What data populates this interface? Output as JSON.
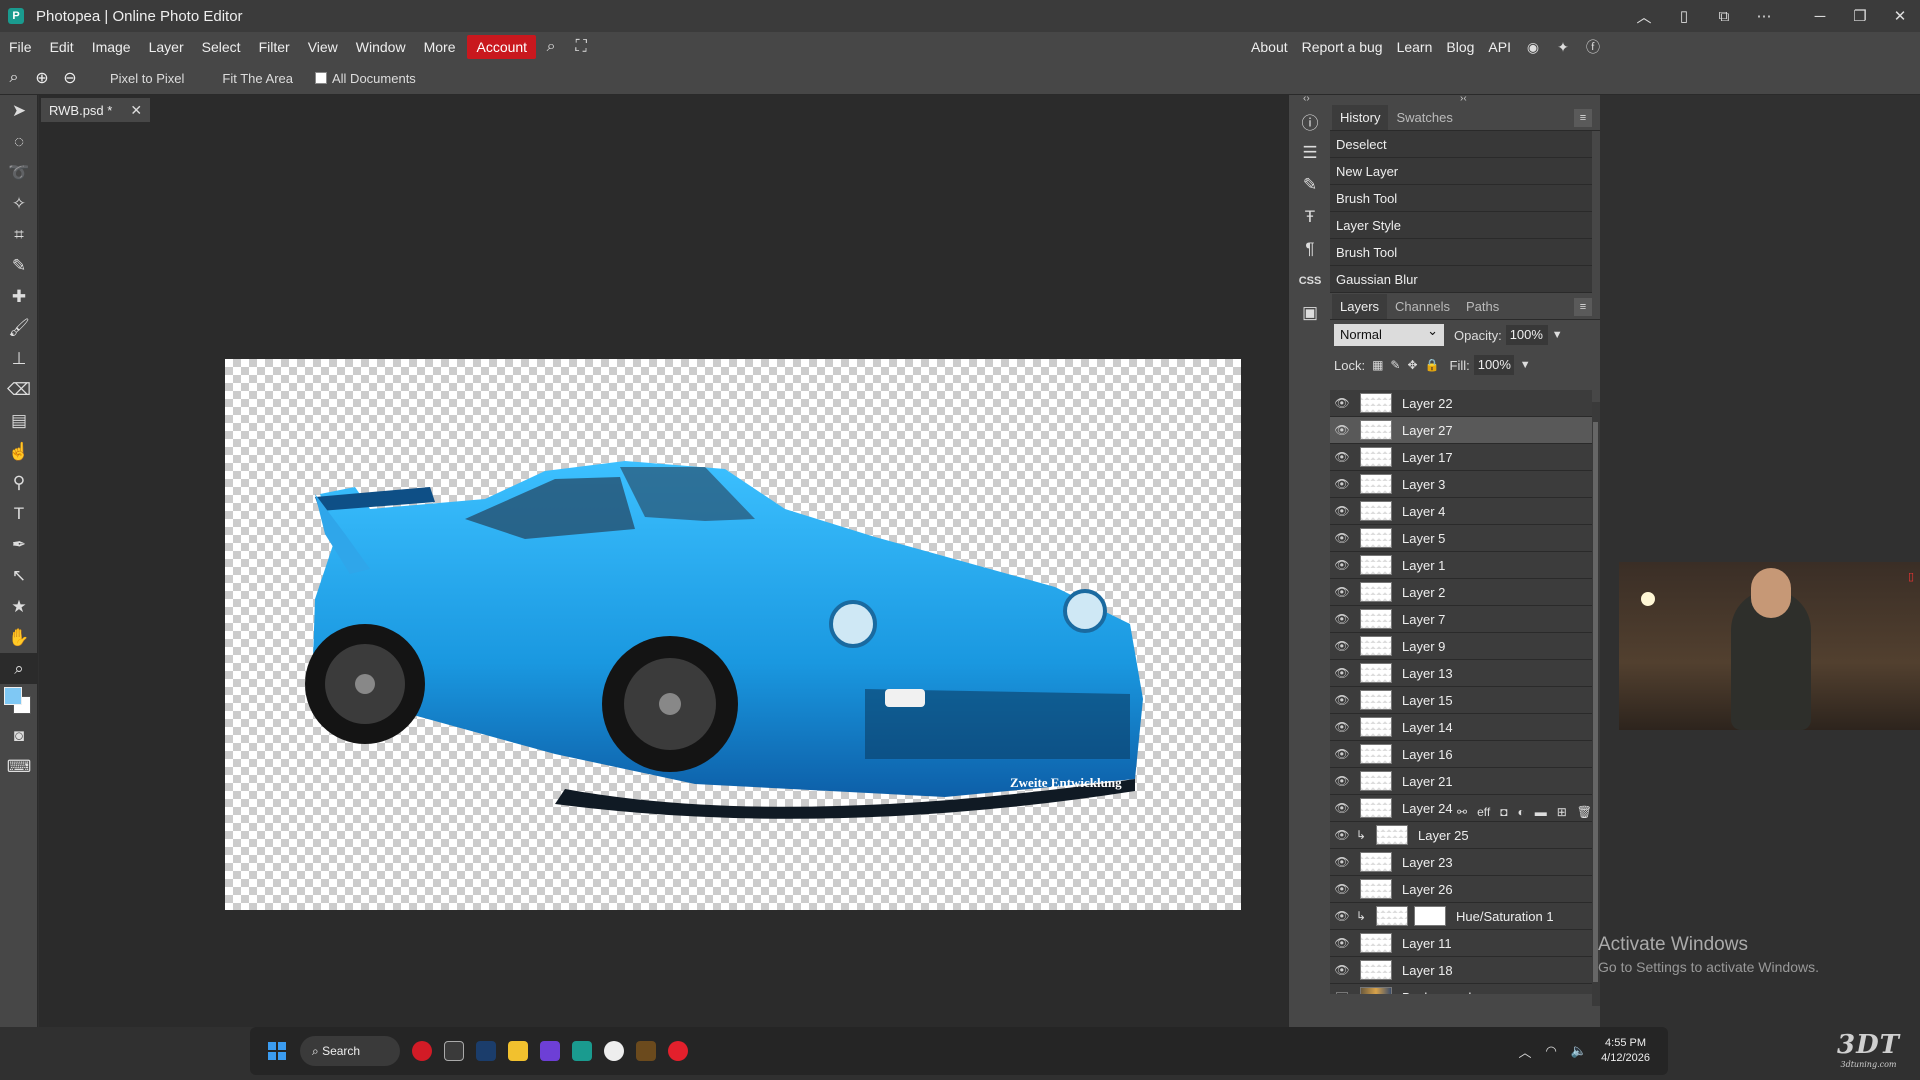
{
  "titlebar": {
    "title": "Photopea | Online Photo Editor",
    "logo_glyph": "P"
  },
  "menu": {
    "items": [
      "File",
      "Edit",
      "Image",
      "Layer",
      "Select",
      "Filter",
      "View",
      "Window",
      "More"
    ],
    "account": "Account",
    "right_links": [
      "About",
      "Report a bug",
      "Learn",
      "Blog",
      "API"
    ]
  },
  "options": {
    "pixel_to_pixel": "Pixel to Pixel",
    "fit_area": "Fit The Area",
    "all_documents": "All Documents"
  },
  "document": {
    "tab_name": "RWB.psd *",
    "car_text": "Zweite Entwicklung"
  },
  "history": {
    "tabs": [
      "History",
      "Swatches"
    ],
    "items": [
      "Deselect",
      "New Layer",
      "Brush Tool",
      "Layer Style",
      "Brush Tool",
      "Gaussian Blur"
    ]
  },
  "layers": {
    "tabs": [
      "Layers",
      "Channels",
      "Paths"
    ],
    "blend_mode": "Normal",
    "opacity_label": "Opacity:",
    "opacity": "100%",
    "lock_label": "Lock:",
    "fill_label": "Fill:",
    "fill": "100%",
    "items": [
      {
        "name": "Layer 22",
        "visible": true
      },
      {
        "name": "Layer 27",
        "visible": true,
        "selected": true
      },
      {
        "name": "Layer 17",
        "visible": true
      },
      {
        "name": "Layer 3",
        "visible": true
      },
      {
        "name": "Layer 4",
        "visible": true
      },
      {
        "name": "Layer 5",
        "visible": true
      },
      {
        "name": "Layer 1",
        "visible": true
      },
      {
        "name": "Layer 2",
        "visible": true
      },
      {
        "name": "Layer 7",
        "visible": true
      },
      {
        "name": "Layer 9",
        "visible": true
      },
      {
        "name": "Layer 13",
        "visible": true
      },
      {
        "name": "Layer 15",
        "visible": true
      },
      {
        "name": "Layer 14",
        "visible": true
      },
      {
        "name": "Layer 16",
        "visible": true
      },
      {
        "name": "Layer 21",
        "visible": true
      },
      {
        "name": "Layer 24",
        "visible": true
      },
      {
        "name": "Layer 25",
        "visible": true,
        "clipped": true
      },
      {
        "name": "Layer 23",
        "visible": true
      },
      {
        "name": "Layer 26",
        "visible": true
      },
      {
        "name": "Hue/Saturation 1",
        "visible": true,
        "clipped": true,
        "adjustment": true
      },
      {
        "name": "Layer 11",
        "visible": true
      },
      {
        "name": "Layer 18",
        "visible": true
      },
      {
        "name": "Background",
        "visible": false,
        "background": true
      }
    ]
  },
  "side_strip": {
    "css_label": "CSS"
  },
  "activate_windows": {
    "line1": "Activate Windows",
    "line2": "Go to Settings to activate Windows."
  },
  "taskbar": {
    "search": "Search",
    "time": "4:55 PM",
    "date": "4/12/2026"
  },
  "watermark": {
    "brand": "3DT",
    "site": "3dtuning.com"
  },
  "colors": {
    "accent_account": "#c9181e",
    "car_blue": "#1e9be3",
    "foreground": "#7fc8f4",
    "background": "#ffffff"
  }
}
